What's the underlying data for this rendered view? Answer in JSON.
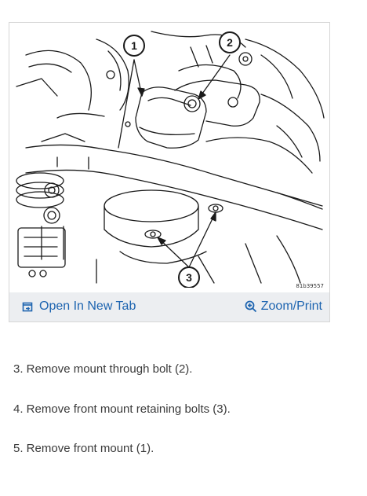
{
  "figure": {
    "figure_id": "81b39557",
    "callouts": [
      "1",
      "2",
      "3"
    ]
  },
  "toolbar": {
    "open_tab_label": "Open In New Tab",
    "open_tab_icon": "open-in-new-tab-icon",
    "zoom_label": "Zoom/Print",
    "zoom_icon": "zoom-in-icon"
  },
  "steps": [
    "3. Remove mount through bolt (2).",
    "4. Remove front mount retaining bolts (3).",
    "5. Remove front mount (1)."
  ],
  "colors": {
    "link": "#1d64b0",
    "toolbar_bg": "#eceef1",
    "text": "#3a3a3a"
  }
}
